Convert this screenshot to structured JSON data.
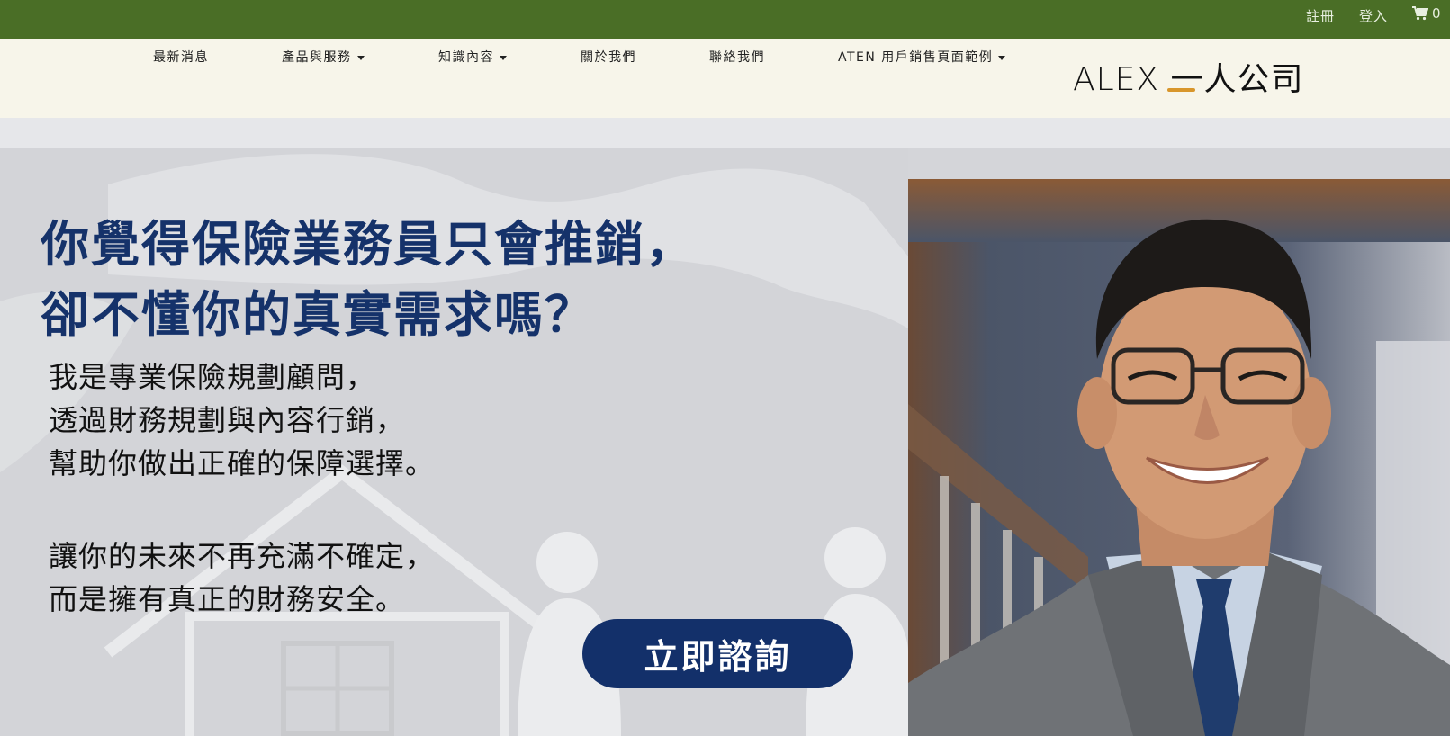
{
  "topbar": {
    "register_label": "註冊",
    "login_label": "登入",
    "cart_count": "0"
  },
  "nav": {
    "items": [
      {
        "label": "最新消息",
        "has_dropdown": false
      },
      {
        "label": "產品與服務",
        "has_dropdown": true
      },
      {
        "label": "知識內容",
        "has_dropdown": true
      },
      {
        "label": "關於我們",
        "has_dropdown": false
      },
      {
        "label": "聯絡我們",
        "has_dropdown": false
      },
      {
        "label": "ATEN 用戶銷售頁面範例",
        "has_dropdown": true
      }
    ],
    "logo_text": "ALEX 一人公司"
  },
  "hero": {
    "headline_line1": "你覺得保險業務員只會推銷，",
    "headline_line2": "卻不懂你的真實需求嗎？",
    "para1_line1": "我是專業保險規劃顧問，",
    "para1_line2": "透過財務規劃與內容行銷，",
    "para1_line3": "幫助你做出正確的保障選擇。",
    "para2_line1": "讓你的未來不再充滿不確定，",
    "para2_line2": "而是擁有真正的財務安全。",
    "cta_label": "立即諮詢"
  },
  "colors": {
    "topbar": "#4a6e26",
    "nav_bg": "#f7f5ea",
    "headline": "#15326a",
    "cta_bg": "#13306a",
    "logo_accent": "#d8962c"
  },
  "icons": {
    "cart": "cart-icon",
    "caret": "chevron-down-icon"
  }
}
